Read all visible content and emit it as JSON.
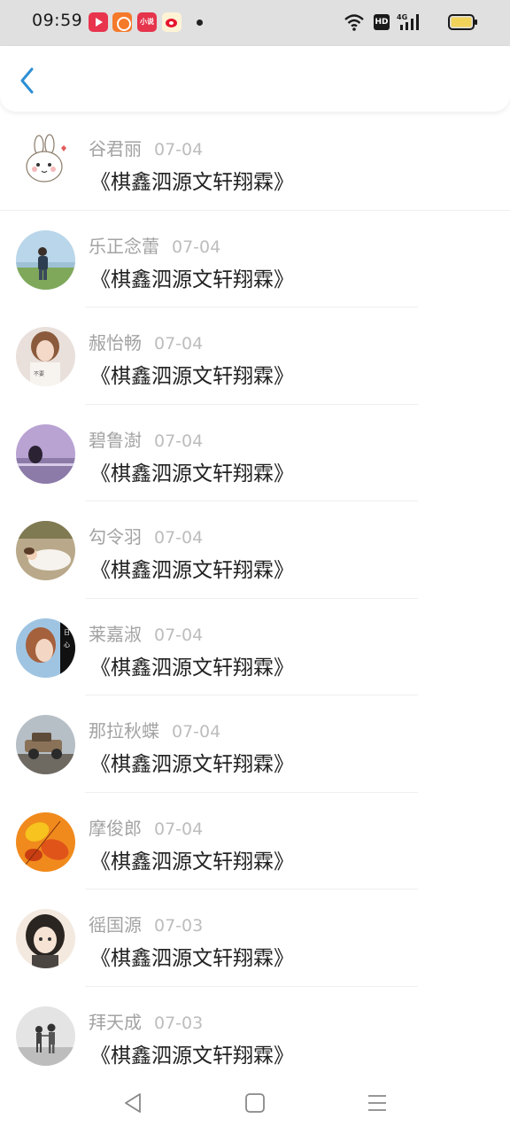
{
  "status_bar": {
    "time": "09:59",
    "notification_icons": [
      "video-app-icon",
      "social-app-icon",
      "mini-app-icon",
      "weibo-icon"
    ],
    "mini_app_label": "小说",
    "network_badge": "HD",
    "network_type": "4G",
    "battery_color": "#f2d35a"
  },
  "header": {
    "back_icon": "chevron-left-icon",
    "accent_color": "#2d8fd5"
  },
  "list": {
    "items": [
      {
        "name": "谷君丽",
        "date": "07-04",
        "title": "《棋鑫泗源文轩翔霖》",
        "avatar": "cartoon-rabbit"
      },
      {
        "name": "乐正念蕾",
        "date": "07-04",
        "title": "《棋鑫泗源文轩翔霖》",
        "avatar": "person-field"
      },
      {
        "name": "赧怡畅",
        "date": "07-04",
        "title": "《棋鑫泗源文轩翔霖》",
        "avatar": "girl-portrait"
      },
      {
        "name": "碧鲁澍",
        "date": "07-04",
        "title": "《棋鑫泗源文轩翔霖》",
        "avatar": "purple-scene"
      },
      {
        "name": "勾令羽",
        "date": "07-04",
        "title": "《棋鑫泗源文轩翔霖》",
        "avatar": "lying-girl"
      },
      {
        "name": "莱嘉淑",
        "date": "07-04",
        "title": "《棋鑫泗源文轩翔霖》",
        "avatar": "girl-side"
      },
      {
        "name": "那拉秋蝶",
        "date": "07-04",
        "title": "《棋鑫泗源文轩翔霖》",
        "avatar": "vintage-car"
      },
      {
        "name": "摩俊郎",
        "date": "07-04",
        "title": "《棋鑫泗源文轩翔霖》",
        "avatar": "autumn-leaves"
      },
      {
        "name": "徭国源",
        "date": "07-03",
        "title": "《棋鑫泗源文轩翔霖》",
        "avatar": "anime-girl"
      },
      {
        "name": "拜天成",
        "date": "07-03",
        "title": "《棋鑫泗源文轩翔霖》",
        "avatar": "children-walking"
      }
    ]
  },
  "nav_bar": {
    "buttons": [
      "back-triangle-icon",
      "home-square-icon",
      "menu-lines-icon"
    ]
  }
}
